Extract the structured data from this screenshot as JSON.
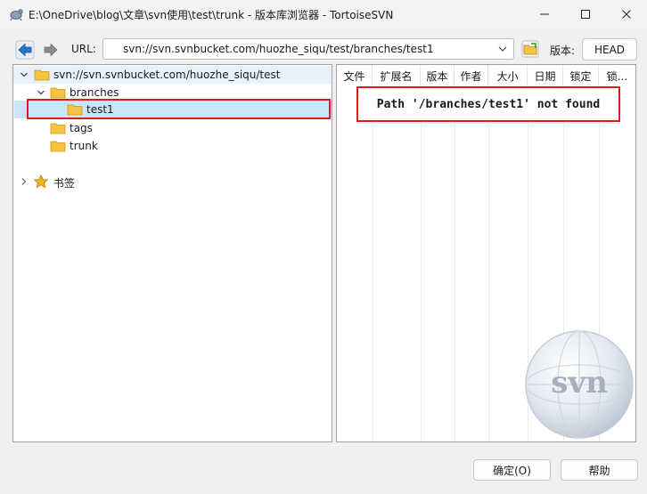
{
  "window": {
    "title": "E:\\OneDrive\\blog\\文章\\svn使用\\test\\trunk - 版本库浏览器 - TortoiseSVN"
  },
  "toolbar": {
    "url_label": "URL:",
    "url_value": "svn://svn.svnbucket.com/huozhe_siqu/test/branches/test1",
    "revision_label": "版本:",
    "revision_button": "HEAD"
  },
  "tree": {
    "root": "svn://svn.svnbucket.com/huozhe_siqu/test",
    "branches": "branches",
    "test1": "test1",
    "tags": "tags",
    "trunk": "trunk",
    "bookmarks": "书签"
  },
  "list": {
    "columns": [
      "文件",
      "扩展名",
      "版本",
      "作者",
      "大小",
      "日期",
      "锁定",
      "锁..."
    ],
    "message": "Path '/branches/test1' not found"
  },
  "logo": {
    "text": "svn"
  },
  "buttons": {
    "ok": "确定(O)",
    "help": "帮助"
  },
  "colors": {
    "highlight_outline": "#e01b1b",
    "selection": "#cce4f7",
    "folder": "#f5c342"
  }
}
